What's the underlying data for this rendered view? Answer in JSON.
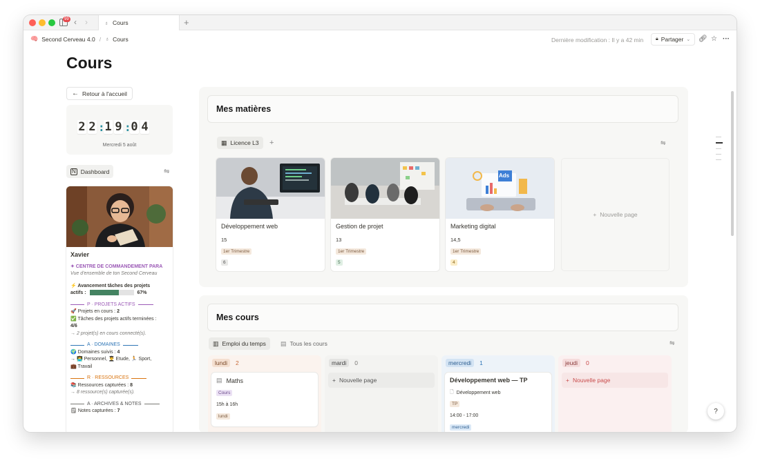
{
  "window": {
    "tab_title": "Cours",
    "notif_count": "99"
  },
  "breadcrumb": {
    "workspace": "Second Cerveau 4.0",
    "separator": "/",
    "page": "Cours"
  },
  "topbar": {
    "last_modified": "Dernière modification : Il y a 42 min",
    "share_label": "Partager"
  },
  "page": {
    "title": "Cours"
  },
  "sidebar": {
    "back_label": "Retour à l'accueil",
    "clock": {
      "h1": "2",
      "h2": "2",
      "m1": "1",
      "m2": "9",
      "s1": "0",
      "s2": "4",
      "date": "Mercredi 5 août"
    },
    "dashboard_label": "Dashboard",
    "profile": {
      "name": "Xavier",
      "command_center": "✦ CENTRE DE COMMANDEMENT PARA",
      "subtitle": "Vue d'ensemble de ton Second Cerveau",
      "progress_label": "⚡ Avancement tâches des projets",
      "progress_label2": "actifs :",
      "progress_value": 0.67,
      "progress_text": "67%",
      "projects_head": "P · PROJETS ACTIFS",
      "projects_in_progress_label": "🚀 Projets en cours :",
      "projects_in_progress_value": "2",
      "tasks_done_label": "✅ Tâches des projets actifs terminées :",
      "tasks_done_value": "4/6",
      "projects_connected": "→ 2 projet(s) en cours connecté(s).",
      "domains_head": "A · DOMAINES",
      "domains_label": "🌍 Domaines suivis :",
      "domains_value": "4",
      "domains_list": "→ 👨‍💻 Personnel, 👨‍🎓 Etude, 🏃 Sport,",
      "domains_list2": "💼 Travail",
      "resources_head": "R · RESSOURCES",
      "resources_label": "📚 Ressources capturées :",
      "resources_value": "8",
      "resources_note": "→ 8 ressource(s) capturée(s).",
      "archives_head": "A · ARCHIVES & NOTES",
      "notes_label": "🗒 Notes capturées :",
      "notes_value": "7"
    }
  },
  "matieres": {
    "title": "Mes matières",
    "view_label": "Licence L3",
    "new_page": "Nouvelle page",
    "cards": [
      {
        "title": "Développement web",
        "number": "15",
        "tag": "1er Trimestre",
        "count": "6"
      },
      {
        "title": "Gestion de projet",
        "number": "13",
        "tag": "1er Trimestre",
        "count": "5"
      },
      {
        "title": "Marketing digital",
        "number": "14,5",
        "tag": "1er Trimestre",
        "count": "4"
      }
    ],
    "ads_text": "Ads"
  },
  "cours": {
    "title": "Mes cours",
    "view_active": "Emploi du temps",
    "view_other": "Tous les cours",
    "new_page": "Nouvelle page",
    "columns": [
      {
        "day": "lundi",
        "count": "2",
        "card_title": "Maths",
        "card_tag": "Cours",
        "card_time": "15h à 16h",
        "card_day": "lundi"
      },
      {
        "day": "mardi",
        "count": "0"
      },
      {
        "day": "mercredi",
        "count": "1",
        "card_title": "Développement web — TP",
        "card_link": "Développement web",
        "card_tag": "TP",
        "card_time": "14:00 - 17:00",
        "card_day": "mercredi"
      },
      {
        "day": "jeudi",
        "count": "0"
      }
    ]
  },
  "colors": {
    "accent_green": "#448361",
    "purple": "#9b59b6",
    "blue": "#2e75b6",
    "orange": "#d9730d"
  }
}
